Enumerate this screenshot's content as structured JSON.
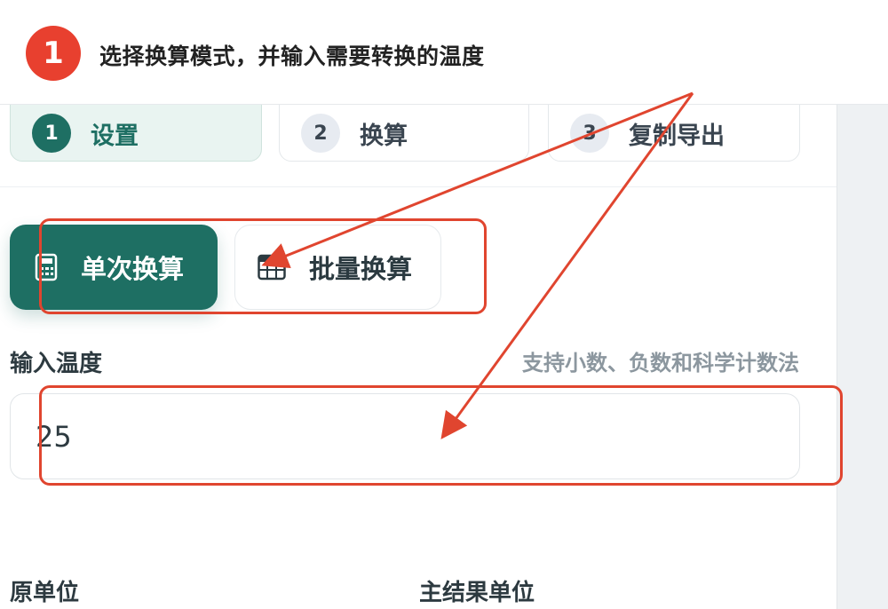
{
  "tutorial": {
    "step_number": "1",
    "instruction": "选择换算模式，并输入需要转换的温度",
    "accent_color": "#e8402f"
  },
  "stepper": {
    "steps": [
      {
        "number": "1",
        "label": "设置",
        "active": true
      },
      {
        "number": "2",
        "label": "换算",
        "active": false
      },
      {
        "number": "3",
        "label": "复制导出",
        "active": false
      }
    ]
  },
  "mode": {
    "single_label": "单次换算",
    "single_icon": "calculator-icon",
    "batch_label": "批量换算",
    "batch_icon": "table-icon",
    "selected": "单次换算"
  },
  "input": {
    "label": "输入温度",
    "hint": "支持小数、负数和科学计数法",
    "value": "25"
  },
  "units": {
    "source_label": "原单位",
    "target_label": "主结果单位"
  },
  "colors": {
    "primary": "#1e6f63",
    "annotation": "#e0452f"
  }
}
